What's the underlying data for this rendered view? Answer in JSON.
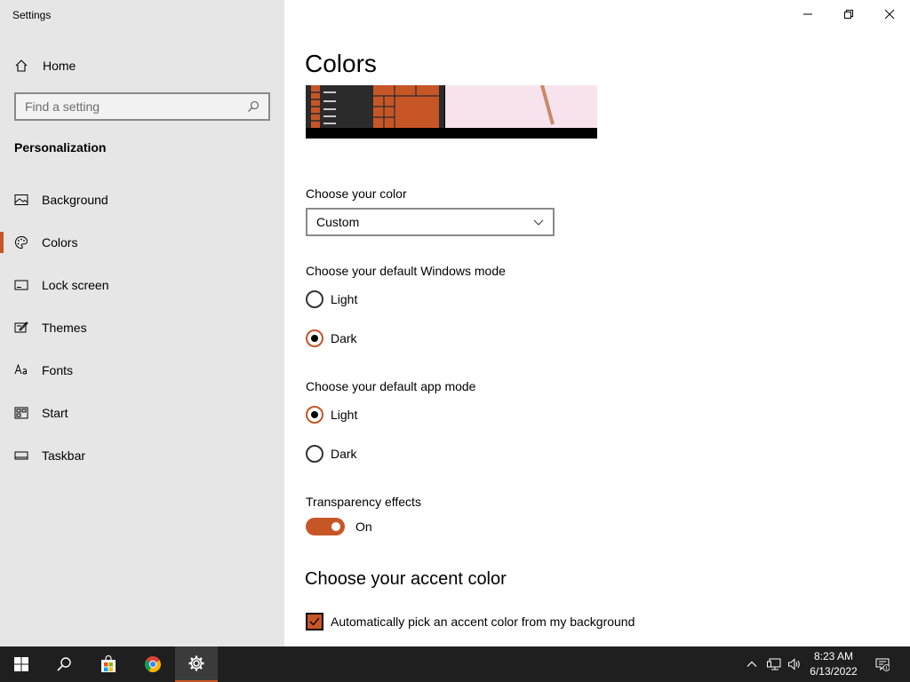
{
  "app": {
    "title": "Settings"
  },
  "sidebar": {
    "home_label": "Home",
    "search_placeholder": "Find a setting",
    "section_title": "Personalization",
    "items": [
      {
        "label": "Background",
        "icon": "picture-icon"
      },
      {
        "label": "Colors",
        "icon": "palette-icon",
        "active": true
      },
      {
        "label": "Lock screen",
        "icon": "lock-screen-icon"
      },
      {
        "label": "Themes",
        "icon": "themes-icon"
      },
      {
        "label": "Fonts",
        "icon": "fonts-icon"
      },
      {
        "label": "Start",
        "icon": "start-icon"
      },
      {
        "label": "Taskbar",
        "icon": "taskbar-icon"
      }
    ]
  },
  "main": {
    "title": "Colors",
    "choose_color_label": "Choose your color",
    "choose_color_value": "Custom",
    "windows_mode_label": "Choose your default Windows mode",
    "windows_mode_options": [
      "Light",
      "Dark"
    ],
    "windows_mode_selected": "Dark",
    "app_mode_label": "Choose your default app mode",
    "app_mode_options": [
      "Light",
      "Dark"
    ],
    "app_mode_selected": "Light",
    "transparency_label": "Transparency effects",
    "transparency_state": "On",
    "accent_heading": "Choose your accent color",
    "auto_accent_label": "Automatically pick an accent color from my background",
    "auto_accent_checked": true
  },
  "taskbar": {
    "time": "8:23 AM",
    "date": "6/13/2022",
    "notification_count": "1"
  },
  "colors": {
    "accent": "#c75627",
    "sidebar_bg": "#e6e6e6",
    "taskbar_bg": "#1f1f1f"
  }
}
